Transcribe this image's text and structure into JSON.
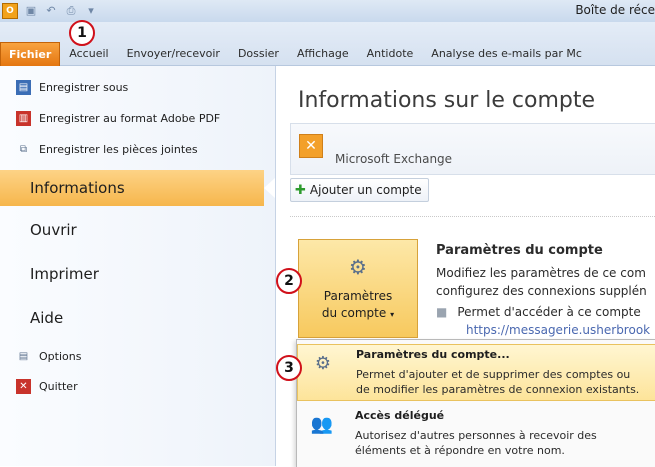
{
  "window": {
    "title": "Boîte de réce"
  },
  "tabs": [
    {
      "label": "Fichier"
    },
    {
      "label": "Accueil"
    },
    {
      "label": "Envoyer/recevoir"
    },
    {
      "label": "Dossier"
    },
    {
      "label": "Affichage"
    },
    {
      "label": "Antidote"
    },
    {
      "label": "Analyse des e-mails par Mc"
    }
  ],
  "nav": {
    "commands": [
      {
        "label": "Enregistrer sous",
        "icon": "save-as-icon"
      },
      {
        "label": "Enregistrer au format Adobe PDF",
        "icon": "pdf-icon"
      },
      {
        "label": "Enregistrer les pièces jointes",
        "icon": "attachments-icon"
      }
    ],
    "tabs": [
      {
        "label": "Informations",
        "active": true
      },
      {
        "label": "Ouvrir"
      },
      {
        "label": "Imprimer"
      },
      {
        "label": "Aide"
      }
    ],
    "bottom": [
      {
        "label": "Options",
        "icon": "options-icon"
      },
      {
        "label": "Quitter",
        "icon": "exit-icon"
      }
    ]
  },
  "main": {
    "title": "Informations sur le compte",
    "account_label": "Microsoft Exchange",
    "add_account": "Ajouter un compte",
    "settings_button_line1": "Paramètres",
    "settings_button_line2": "du compte",
    "section_title": "Paramètres du compte",
    "section_desc_1": "Modifiez les paramètres de ce com",
    "section_desc_2": "configurez des connexions supplén",
    "section_bullet": "Permet d'accéder à ce compte",
    "section_link": "https://messagerie.usherbrook"
  },
  "dropdown": [
    {
      "title": "Paramètres du compte...",
      "desc_1": "Permet d'ajouter et de supprimer des comptes ou",
      "desc_2": "de modifier les paramètres de connexion existants."
    },
    {
      "title": "Accès délégué",
      "desc_1": "Autorisez d'autres personnes à recevoir des",
      "desc_2": "éléments et à répondre en votre nom."
    }
  ],
  "callouts": [
    "1",
    "2",
    "3"
  ],
  "colors": {
    "file_tab": "#e47611",
    "active_nav": "#f6b64c",
    "callout_ring": "#d0101a"
  }
}
